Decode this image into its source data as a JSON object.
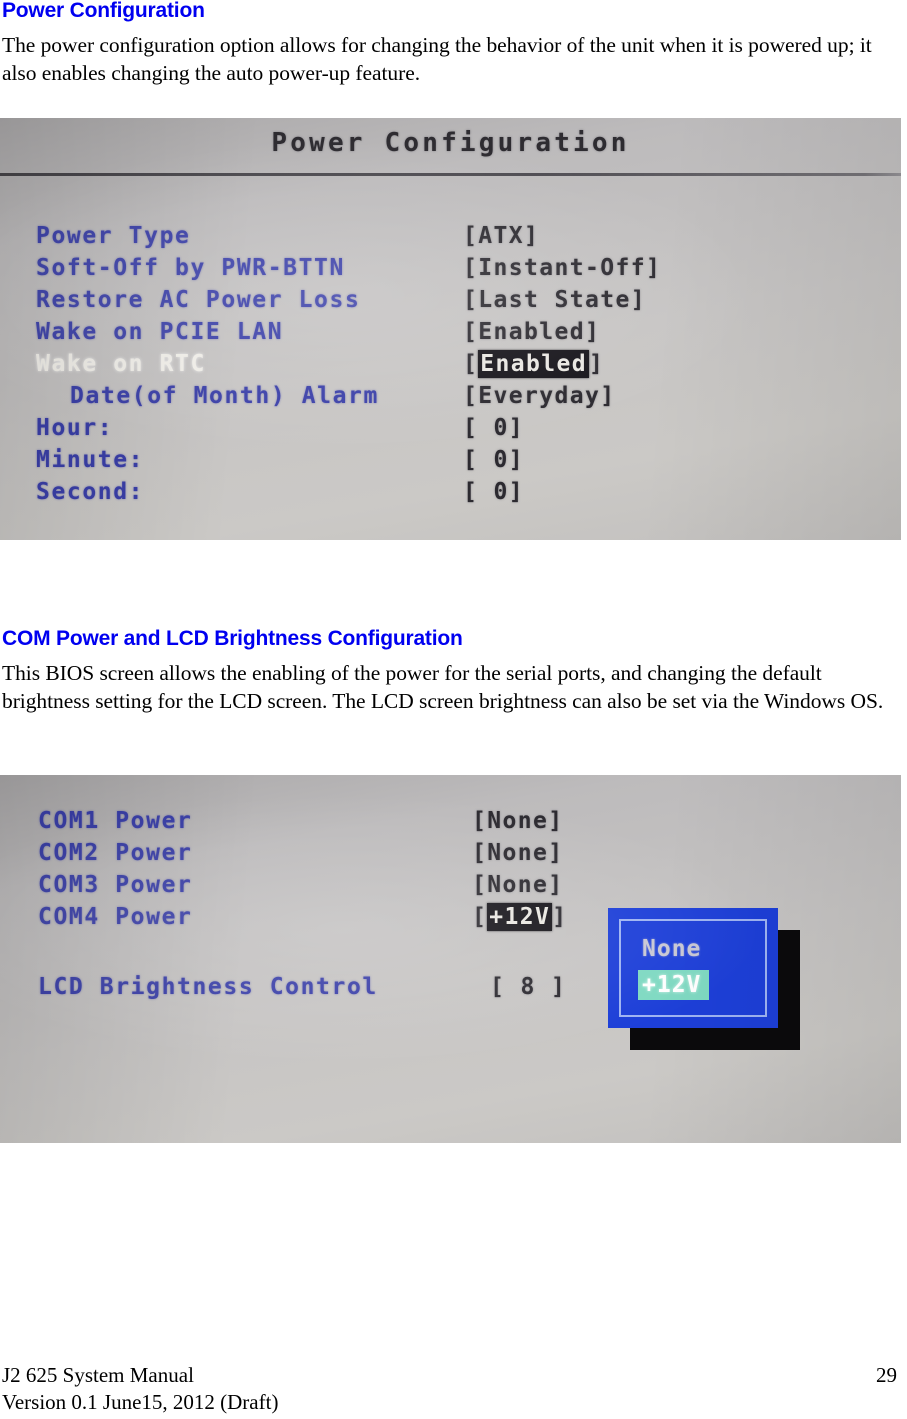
{
  "sections": [
    {
      "heading": "Power Configuration",
      "paragraph": "The power configuration option allows for changing the behavior of the unit when it is powered up; it also enables changing the auto power-up feature."
    },
    {
      "heading": "COM Power and LCD Brightness Configuration",
      "paragraph": "This BIOS screen allows the enabling of the power for the serial ports, and changing the default brightness setting for the LCD screen. The LCD screen brightness can also be set via the Windows OS."
    }
  ],
  "bios_screen_1": {
    "title": "Power Configuration",
    "rows": [
      {
        "label": "Power Type",
        "value_open": "[",
        "value": "ATX",
        "value_close": "]",
        "highlighted": false,
        "selected": false,
        "indented": false
      },
      {
        "label": "Soft-Off by PWR-BTTN",
        "value_open": "[",
        "value": "Instant-Off",
        "value_close": "]",
        "highlighted": false,
        "selected": false,
        "indented": false
      },
      {
        "label": "Restore AC Power Loss",
        "value_open": "[",
        "value": "Last State",
        "value_close": "]",
        "highlighted": false,
        "selected": false,
        "indented": false
      },
      {
        "label": "Wake on PCIE LAN",
        "value_open": "[",
        "value": "Enabled",
        "value_close": "]",
        "highlighted": false,
        "selected": false,
        "indented": false
      },
      {
        "label": "Wake on RTC",
        "value_open": "[",
        "value": "Enabled",
        "value_close": "]",
        "highlighted": true,
        "selected": true,
        "indented": false
      },
      {
        "label": "Date(of Month) Alarm",
        "value_open": "[",
        "value": "Everyday",
        "value_close": "]",
        "highlighted": false,
        "selected": false,
        "indented": true
      },
      {
        "label": "Hour:",
        "value_open": "[",
        "value": " 0",
        "value_close": "]",
        "highlighted": false,
        "selected": false,
        "indented": false
      },
      {
        "label": "Minute:",
        "value_open": "[",
        "value": " 0",
        "value_close": "]",
        "highlighted": false,
        "selected": false,
        "indented": false
      },
      {
        "label": "Second:",
        "value_open": "[",
        "value": " 0",
        "value_close": "]",
        "highlighted": false,
        "selected": false,
        "indented": false
      }
    ]
  },
  "bios_screen_2": {
    "rows": [
      {
        "label": "COM1 Power",
        "value_open": "[",
        "value": "None",
        "value_close": "]",
        "highlighted": false,
        "selected": false
      },
      {
        "label": "COM2 Power",
        "value_open": "[",
        "value": "None",
        "value_close": "]",
        "highlighted": false,
        "selected": false
      },
      {
        "label": "COM3 Power",
        "value_open": "[",
        "value": "None",
        "value_close": "]",
        "highlighted": false,
        "selected": false
      },
      {
        "label": "COM4 Power",
        "value_open": "[",
        "value": "+12V",
        "value_close": "]",
        "highlighted": true,
        "selected": false
      }
    ],
    "brightness": {
      "label": "LCD Brightness Control",
      "value_open": "[",
      "value": " 8 ",
      "value_close": "]"
    },
    "popup": {
      "options": [
        {
          "label": "None",
          "selected": false
        },
        {
          "label": "+12V",
          "selected": true
        }
      ]
    }
  },
  "footer": {
    "line1": "J2 625 System Manual",
    "line2": "Version 0.1 June15, 2012 (Draft)",
    "page_number": "29"
  },
  "colors": {
    "heading_blue": "#0000f0",
    "bios_label_blue": "#3a3fa8",
    "bios_selected_white": "#f2f0ea",
    "bios_highlight_bg": "#16141a",
    "popup_blue": "#1d3fd8",
    "popup_selection_teal": "#7fd9c2"
  }
}
